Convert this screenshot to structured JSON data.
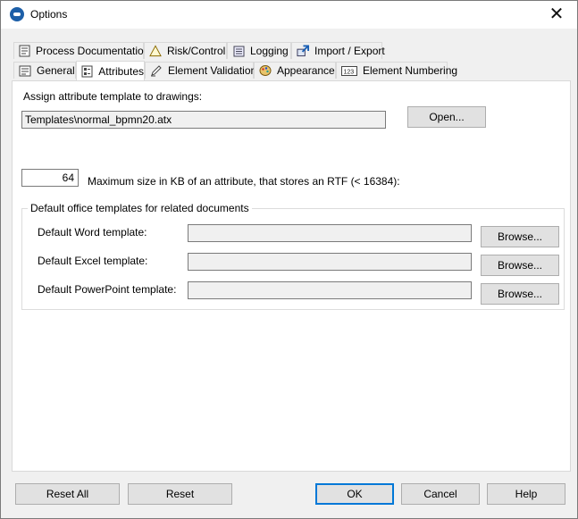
{
  "window": {
    "title": "Options"
  },
  "tabs_back": [
    {
      "label": "Process Documentation",
      "icon": "document-icon"
    },
    {
      "label": "Risk/Control",
      "icon": "warning-triangle-icon"
    },
    {
      "label": "Logging",
      "icon": "log-list-icon"
    },
    {
      "label": "Import / Export",
      "icon": "import-export-icon"
    }
  ],
  "tabs_front": [
    {
      "label": "General",
      "icon": "general-icon"
    },
    {
      "label": "Attributes",
      "icon": "attributes-icon",
      "active": true
    },
    {
      "label": "Element Validation",
      "icon": "pencil-check-icon"
    },
    {
      "label": "Appearance",
      "icon": "palette-icon"
    },
    {
      "label": "Element Numbering",
      "icon": "numbering-icon"
    }
  ],
  "attributes": {
    "assign_label": "Assign attribute template to drawings:",
    "template_path": "Templates\\normal_bpmn20.atx",
    "open_button": "Open...",
    "max_size_value": "64",
    "max_size_label": "Maximum size in KB of an attribute, that stores an RTF (< 16384):",
    "office_group": {
      "title": "Default office templates for related documents",
      "rows": [
        {
          "label": "Default Word template:",
          "value": "",
          "button": "Browse..."
        },
        {
          "label": "Default Excel template:",
          "value": "",
          "button": "Browse..."
        },
        {
          "label": "Default PowerPoint template:",
          "value": "",
          "button": "Browse..."
        }
      ]
    }
  },
  "footer": {
    "reset_all": "Reset All",
    "reset": "Reset",
    "ok": "OK",
    "cancel": "Cancel",
    "help": "Help"
  }
}
